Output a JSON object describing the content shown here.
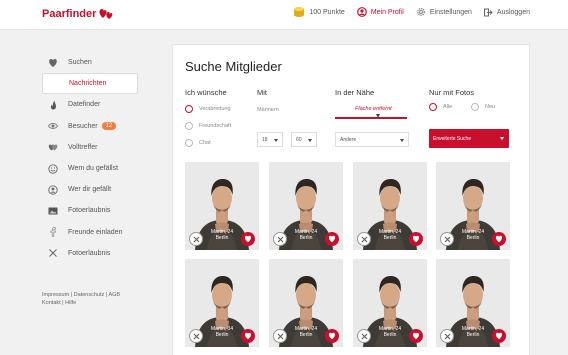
{
  "header": {
    "logo": "Paarfinder",
    "nav": [
      {
        "id": "punkte",
        "label": "100 Punkte",
        "icon": "coins-icon"
      },
      {
        "id": "profil",
        "label": "Mein Profil",
        "icon": "user-circle-icon"
      },
      {
        "id": "einstellungen",
        "label": "Einstellungen",
        "icon": "gear-icon"
      },
      {
        "id": "ausloggen",
        "label": "Ausloggen",
        "icon": "logout-icon"
      }
    ]
  },
  "sidebar": {
    "items": [
      {
        "label": "Suchen",
        "icon": "heart-icon"
      },
      {
        "label": "Nachrichten",
        "icon": "none",
        "active": true
      },
      {
        "label": "Datefinder",
        "icon": "flame-icon"
      },
      {
        "label": "Besucher",
        "icon": "eye-icon",
        "badge": "12"
      },
      {
        "label": "Volltreffer",
        "icon": "double-heart-icon"
      },
      {
        "label": "Wem du gefällst",
        "icon": "smile-icon"
      },
      {
        "label": "Wer dir gefällt",
        "icon": "user-icon"
      },
      {
        "label": "Fotoerlaubnis",
        "icon": "image-icon"
      },
      {
        "label": "Freunde einladen",
        "icon": "facebook-icon"
      },
      {
        "label": "Fotoerlaubnis",
        "icon": "x-icon"
      }
    ],
    "footer_line1": "Impressum | Datenschutz | AGB",
    "footer_line2": "Kontakt | Hilfe"
  },
  "main": {
    "title": "Suche Mitglieder",
    "filters": {
      "wunsch": {
        "label": "Ich wünsche",
        "options": [
          "Verabredung",
          "Freundschaft",
          "Chat"
        ],
        "selected": 0
      },
      "mit": {
        "label": "Mit",
        "value": "Männern",
        "age_from": "18",
        "age_to": "60"
      },
      "naehe": {
        "label": "In der Nähe",
        "range_text": "Fläche entfernt",
        "range_value_fraction": 0.6,
        "location": "Andere"
      },
      "fotos": {
        "label": "Nur mit Fotos",
        "options": [
          "Alle",
          "Neu"
        ],
        "selected": 0,
        "sort": "Erweiterte Suche"
      }
    },
    "members": [
      {
        "name": "Martin, 24",
        "city": "Berlin"
      },
      {
        "name": "Martin, 24",
        "city": "Berlin"
      },
      {
        "name": "Martin, 24",
        "city": "Berlin"
      },
      {
        "name": "Martin, 24",
        "city": "Berlin"
      },
      {
        "name": "Martin, 34",
        "city": "Berlin"
      },
      {
        "name": "Martin, 24",
        "city": "Berlin"
      },
      {
        "name": "Martin, 24",
        "city": "Berlin"
      },
      {
        "name": "Martin, 24",
        "city": "Berlin"
      }
    ]
  },
  "colors": {
    "brand": "#c8102e",
    "badge": "#f47c3c",
    "background": "#f1f1f1"
  }
}
